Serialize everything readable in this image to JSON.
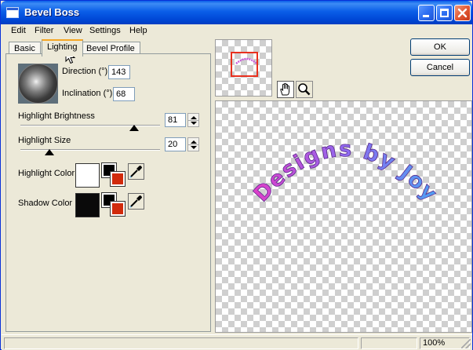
{
  "window": {
    "title": "Bevel Boss"
  },
  "menu": [
    "Edit",
    "Filter",
    "View",
    "Settings",
    "Help"
  ],
  "tabs": [
    "Basic",
    "Lighting",
    "Bevel Profile"
  ],
  "active_tab": "Lighting",
  "lighting": {
    "direction_label": "Direction (°)",
    "direction_value": "143",
    "inclination_label": "Inclination (°)",
    "inclination_value": "68",
    "highlight_brightness_label": "Highlight Brightness",
    "highlight_brightness_value": "81",
    "highlight_size_label": "Highlight Size",
    "highlight_size_value": "20",
    "highlight_color_label": "Highlight Color",
    "shadow_color_label": "Shadow Color"
  },
  "colors": {
    "highlight": "#ffffff",
    "shadow": "#0a0a0a",
    "swatch_fg": "#000000",
    "swatch_bg": "#d12a0c",
    "nav_rect": "#e8301e",
    "preview_text_gradient": [
      "#e23cc6",
      "#8f6af0",
      "#4aa3f2"
    ]
  },
  "preview": {
    "text": "Designs by Joy",
    "tools": [
      "hand-icon",
      "magnifier-icon"
    ]
  },
  "buttons": {
    "ok": "OK",
    "cancel": "Cancel"
  },
  "status": {
    "zoom": "100%"
  }
}
